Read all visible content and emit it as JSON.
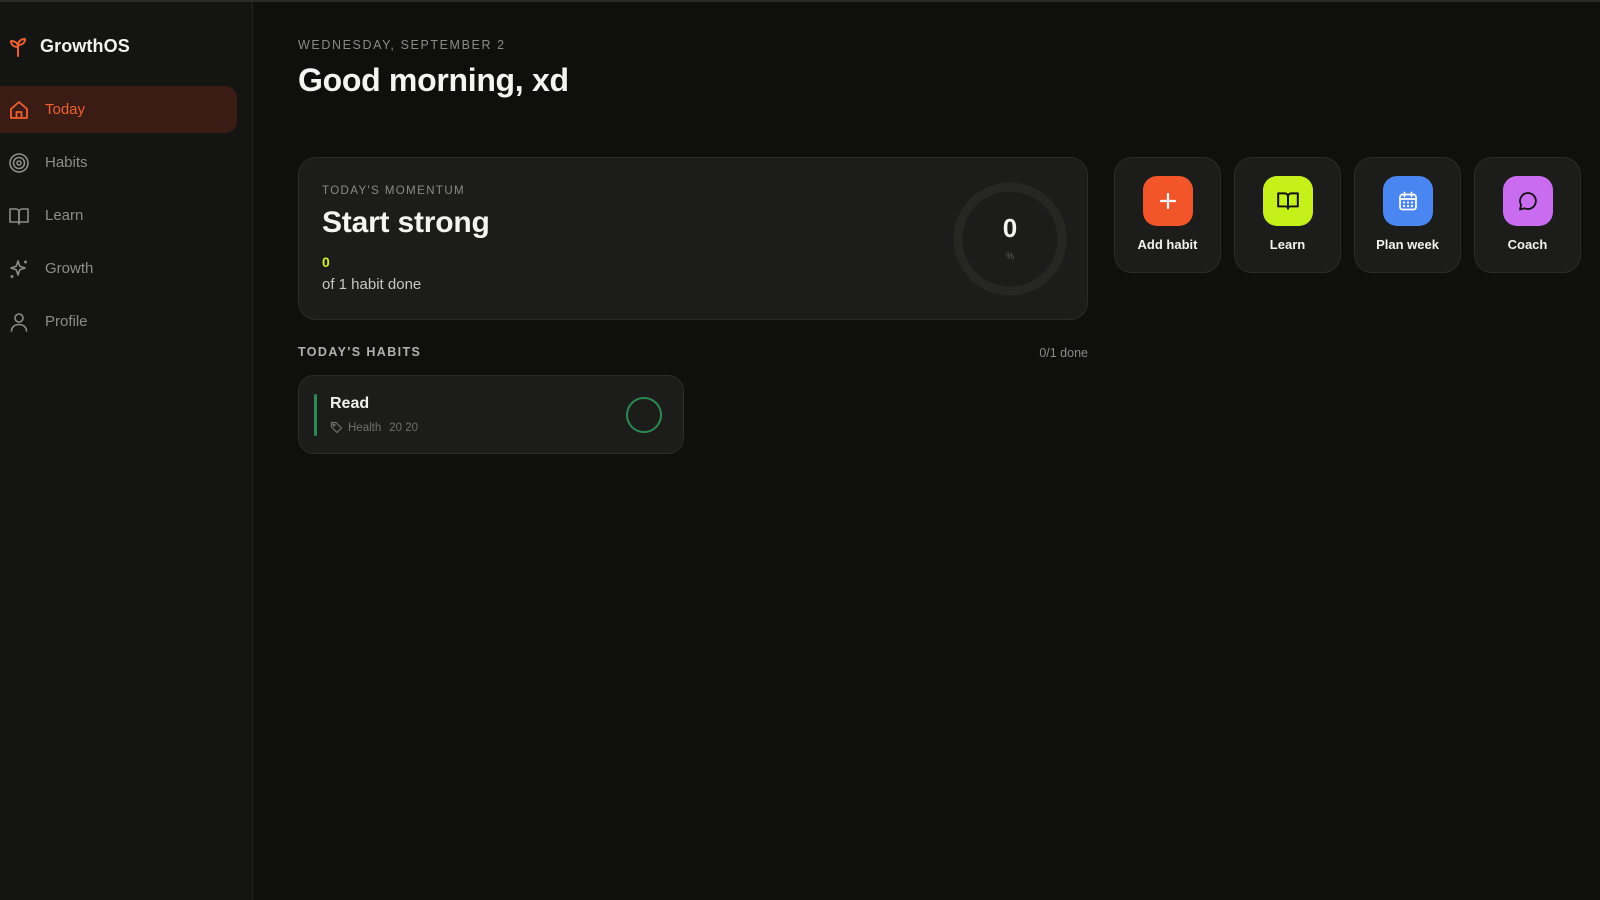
{
  "app": {
    "name": "GrowthOS"
  },
  "sidebar": {
    "items": [
      {
        "label": "Today",
        "icon": "home-icon",
        "active": true
      },
      {
        "label": "Habits",
        "icon": "target-icon",
        "active": false
      },
      {
        "label": "Learn",
        "icon": "book-icon",
        "active": false
      },
      {
        "label": "Growth",
        "icon": "sparkles-icon",
        "active": false
      },
      {
        "label": "Profile",
        "icon": "user-icon",
        "active": false
      }
    ]
  },
  "header": {
    "date": "WEDNESDAY, SEPTEMBER 2",
    "greeting": "Good morning, xd"
  },
  "momentum": {
    "label": "TODAY'S MOMENTUM",
    "title": "Start strong",
    "done_count": "0",
    "subtitle": "of 1 habit done",
    "percent": "0",
    "percent_unit": "%",
    "progress_fraction": 0
  },
  "actions": [
    {
      "label": "Add habit",
      "icon": "plus-icon",
      "color": "#f2552a"
    },
    {
      "label": "Learn",
      "icon": "book-icon",
      "color": "#c6f01a"
    },
    {
      "label": "Plan week",
      "icon": "calendar-icon",
      "color": "#4a86f2"
    },
    {
      "label": "Coach",
      "icon": "chat-bubble-icon",
      "color": "#c96cf0"
    }
  ],
  "habits": {
    "heading": "TODAY'S HABITS",
    "count_text": "0/1 done",
    "items": [
      {
        "title": "Read",
        "category": "Health",
        "time": "20 20",
        "accent": "#2a8a52",
        "done": false
      }
    ]
  },
  "colors": {
    "accent": "#f0602e",
    "highlight": "#d4f21c",
    "background": "#0f0f0d",
    "card": "#1c1c1a"
  }
}
